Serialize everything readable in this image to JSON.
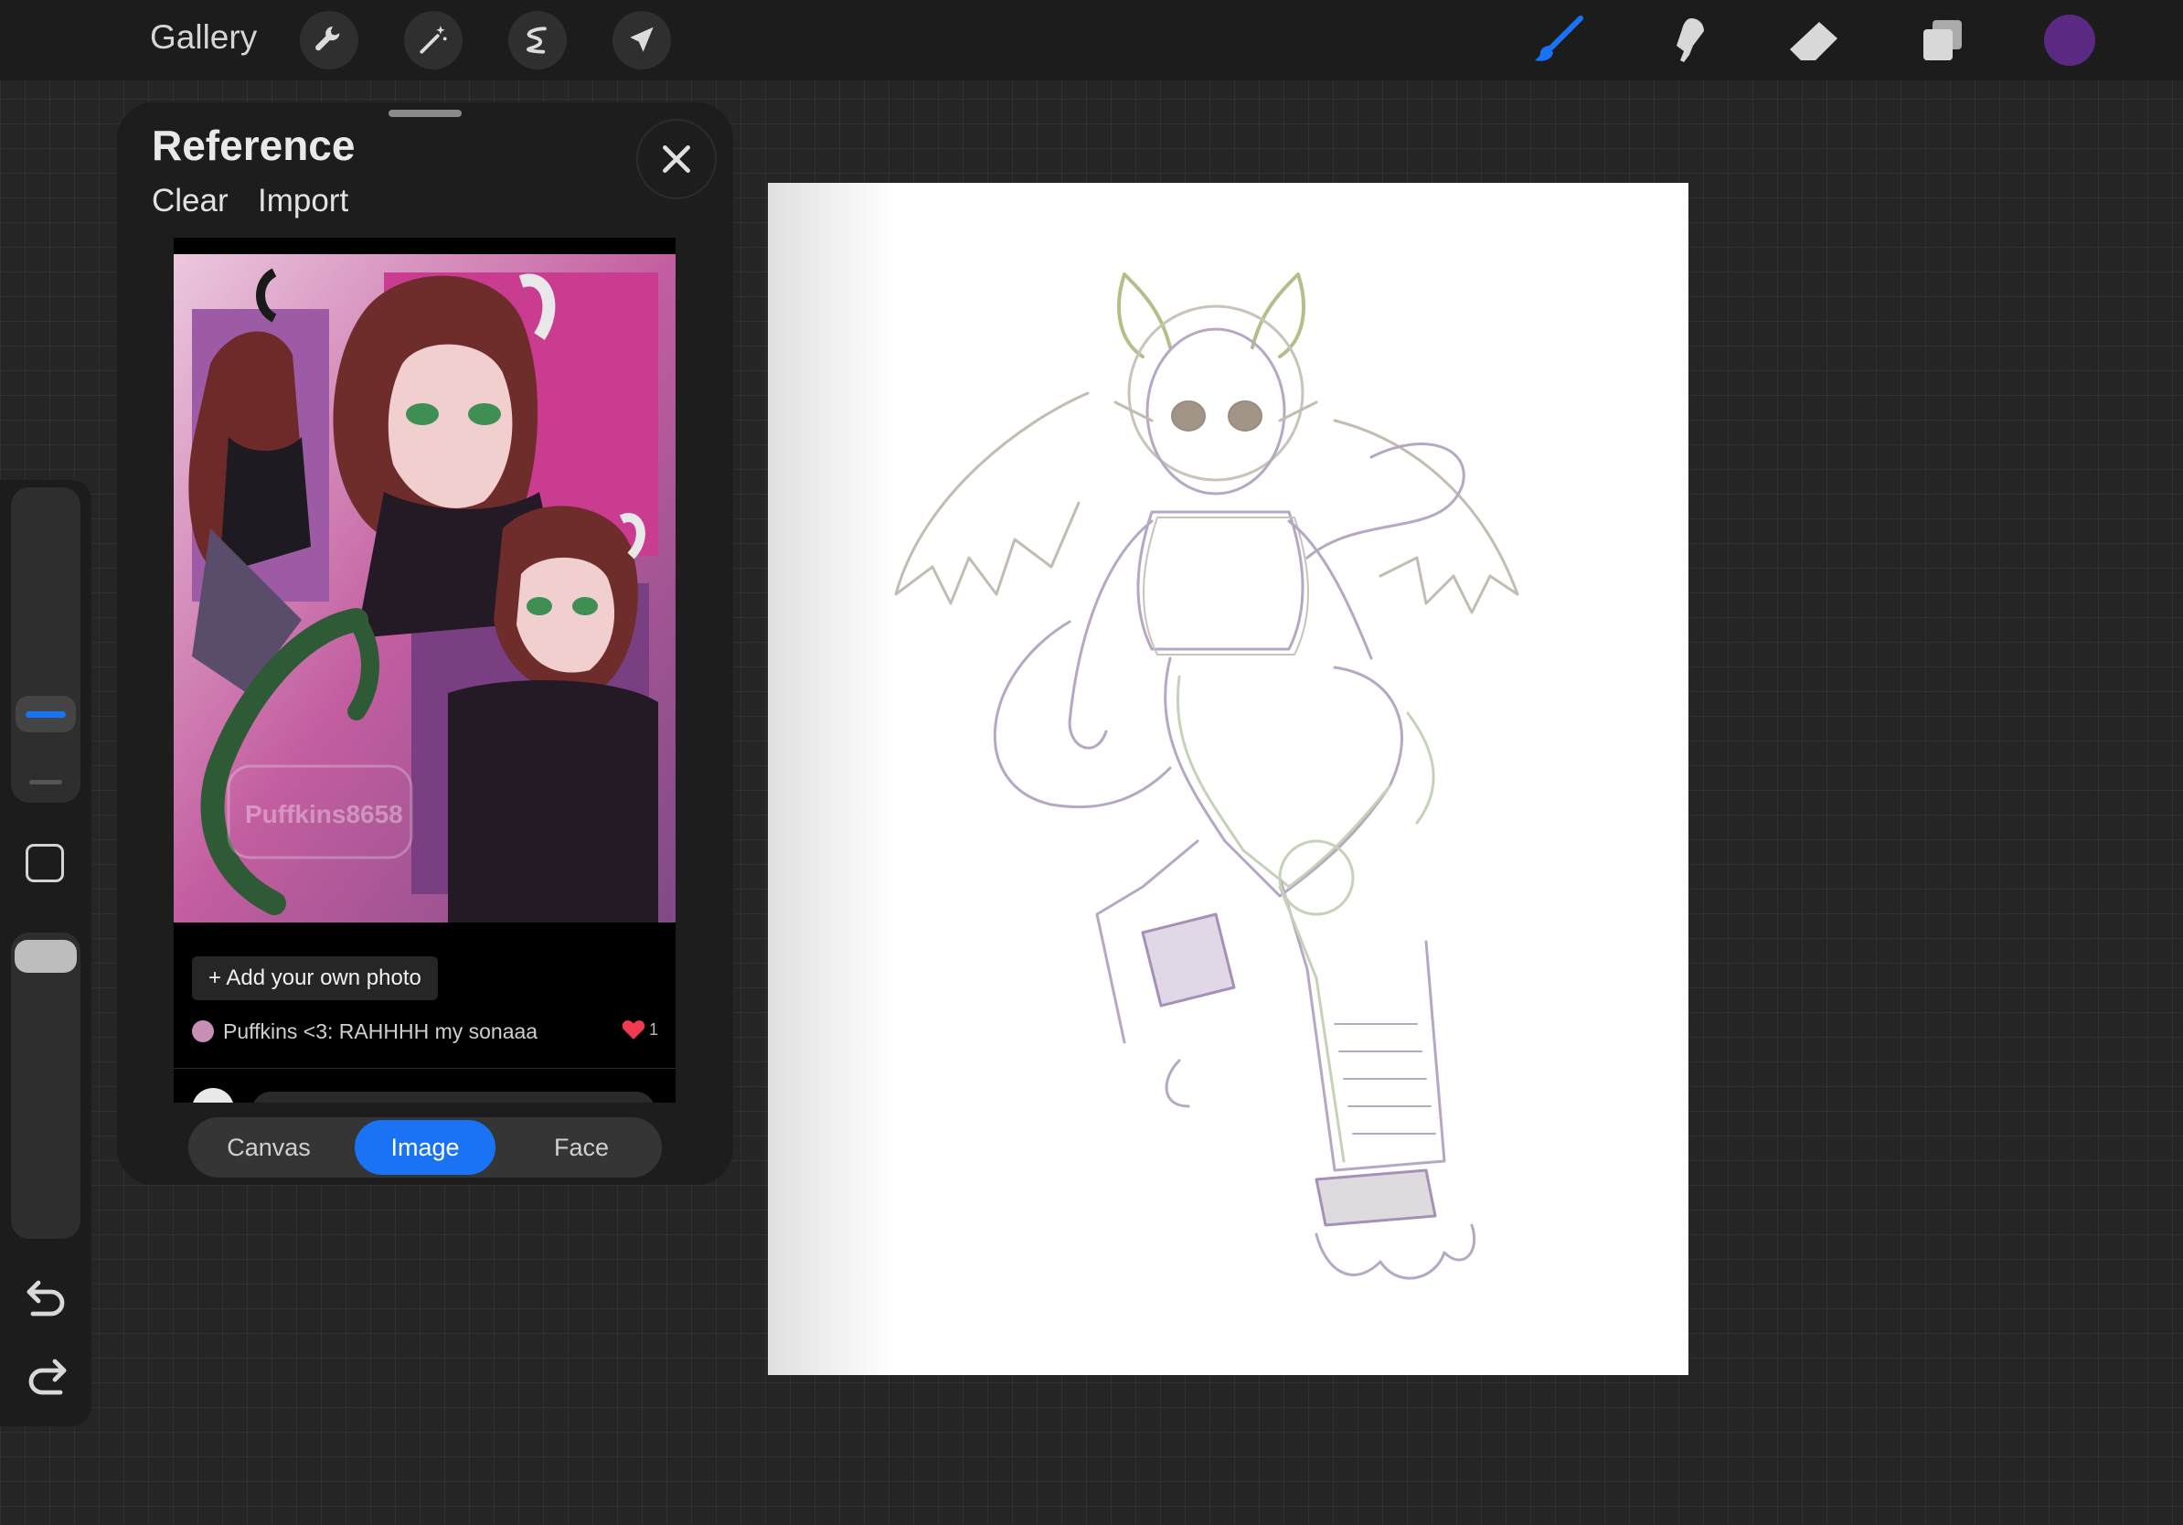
{
  "topbar": {
    "gallery_label": "Gallery",
    "left_tools": [
      "wrench-icon",
      "magic-wand-icon",
      "selection-icon",
      "transform-arrow-icon"
    ],
    "right_tools": [
      "brush-icon",
      "smudge-icon",
      "eraser-icon",
      "layers-icon"
    ],
    "current_color": "#5a2a82"
  },
  "sidebar": {
    "controls": [
      "brush-size-slider",
      "modify-button",
      "opacity-slider",
      "undo-icon",
      "redo-icon"
    ],
    "accent_color": "#1476f2"
  },
  "reference": {
    "title": "Reference",
    "clear_label": "Clear",
    "import_label": "Import",
    "watermark": "Puffkins8658",
    "add_photo_label": "+ Add your own photo",
    "caption": "Puffkins <3: RAHHHH my sonaaa",
    "like_count": "1",
    "tabs": [
      {
        "label": "Canvas",
        "active": false
      },
      {
        "label": "Image",
        "active": true
      },
      {
        "label": "Face",
        "active": false
      }
    ]
  },
  "canvas": {
    "sketch_colors": [
      "#a690b8",
      "#b9b3a8",
      "#b8c49a"
    ]
  }
}
